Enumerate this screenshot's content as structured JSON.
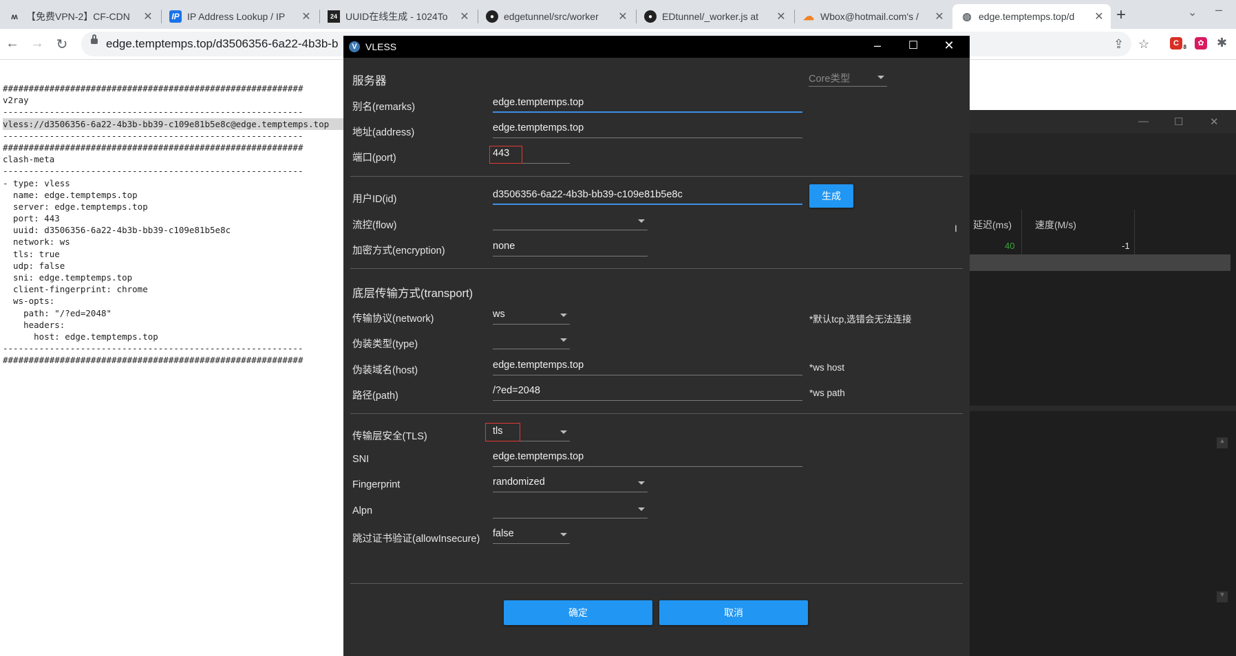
{
  "browser": {
    "tabs": [
      {
        "title": "【免费VPN-2】CF-CDN",
        "icon": "M"
      },
      {
        "title": "IP Address Lookup / IP",
        "icon": "IP"
      },
      {
        "title": "UUID在线生成 - 1024To",
        "icon": "24"
      },
      {
        "title": "edgetunnel/src/worker",
        "icon": "github"
      },
      {
        "title": "EDtunnel/_worker.js at",
        "icon": "github"
      },
      {
        "title": "Wbox@hotmail.com's /",
        "icon": "cloud"
      },
      {
        "title": "edge.temptemps.top/d",
        "icon": "globe"
      }
    ],
    "url": "edge.temptemps.top/d3506356-6a22-4b3b-b",
    "extension_badge": "8"
  },
  "page": {
    "lines": [
      "##########################################################",
      "v2ray",
      "----------------------------------------------------------",
      "vless://d3506356-6a22-4b3b-bb39-c109e81b5e8c@edge.temptemps.top",
      "----------------------------------------------------------",
      "##########################################################",
      "clash-meta",
      "----------------------------------------------------------",
      "- type: vless",
      "  name: edge.temptemps.top",
      "  server: edge.temptemps.top",
      "  port: 443",
      "  uuid: d3506356-6a22-4b3b-bb39-c109e81b5e8c",
      "  network: ws",
      "  tls: true",
      "  udp: false",
      "  sni: edge.temptemps.top",
      "  client-fingerprint: chrome",
      "  ws-opts:",
      "    path: \"/?ed=2048\"",
      "    headers:",
      "      host: edge.temptemps.top",
      "----------------------------------------------------------",
      "##########################################################"
    ]
  },
  "bgapp": {
    "col_latency": "延迟(ms)",
    "col_speed": "速度(M/s)",
    "row_latency": "40",
    "row_speed": "-1"
  },
  "dialog": {
    "title": "VLESS",
    "server_section": "服务器",
    "core_type_placeholder": "Core类型",
    "remarks_label": "别名(remarks)",
    "remarks_value": "edge.temptemps.top",
    "address_label": "地址(address)",
    "address_value": "edge.temptemps.top",
    "port_label": "端口(port)",
    "port_value": "443",
    "id_label": "用户ID(id)",
    "id_value": "d3506356-6a22-4b3b-bb39-c109e81b5e8c",
    "generate_label": "生成",
    "flow_label": "流控(flow)",
    "flow_value": "",
    "encryption_label": "加密方式(encryption)",
    "encryption_value": "none",
    "transport_section": "底层传输方式(transport)",
    "network_label": "传输协议(network)",
    "network_value": "ws",
    "network_hint": "*默认tcp,选错会无法连接",
    "type_label": "伪装类型(type)",
    "type_value": "",
    "host_label": "伪装域名(host)",
    "host_value": "edge.temptemps.top",
    "host_hint": "*ws host",
    "path_label": "路径(path)",
    "path_value": "/?ed=2048",
    "path_hint": "*ws path",
    "tls_label": "传输层安全(TLS)",
    "tls_value": "tls",
    "sni_label": "SNI",
    "sni_value": "edge.temptemps.top",
    "fingerprint_label": "Fingerprint",
    "fingerprint_value": "randomized",
    "alpn_label": "Alpn",
    "alpn_value": "",
    "allowinsecure_label": "跳过证书验证(allowInsecure)",
    "allowinsecure_value": "false",
    "ok_label": "确定",
    "cancel_label": "取消"
  },
  "colors": {
    "dialog_bg": "#2d2d2d",
    "accent": "#2196f3",
    "highlight_box": "#e53935",
    "latency_green": "#3aa53a"
  }
}
